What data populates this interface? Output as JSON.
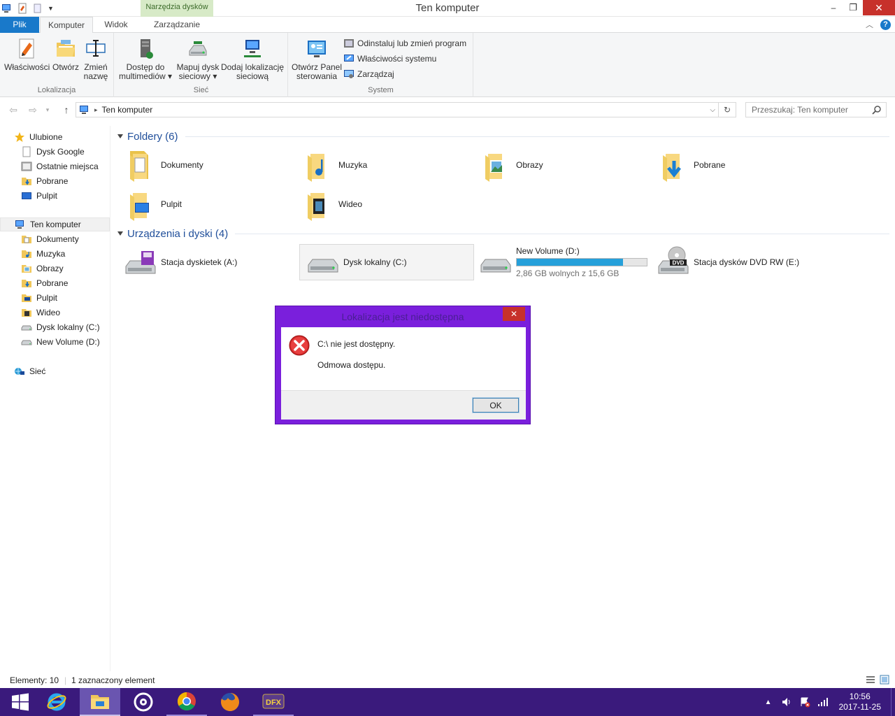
{
  "window": {
    "title": "Ten komputer",
    "context_tab_header": "Narzędzia dysków"
  },
  "ribbon_tabs": {
    "plik": "Plik",
    "komputer": "Komputer",
    "widok": "Widok",
    "zarzadzanie": "Zarządzanie"
  },
  "ribbon": {
    "groups": {
      "lokalizacja": "Lokalizacja",
      "siec": "Sieć",
      "system": "System"
    },
    "buttons": {
      "wlasciwosci": "Właściwości",
      "otworz": "Otwórz",
      "zmien_1": "Zmień",
      "zmien_2": "nazwę",
      "dostep_1": "Dostęp do",
      "dostep_2": "multimediów",
      "mapuj_1": "Mapuj dysk",
      "mapuj_2": "sieciowy",
      "dodaj_1": "Dodaj lokalizację",
      "dodaj_2": "sieciową",
      "panel_1": "Otwórz Panel",
      "panel_2": "sterowania",
      "odinstaluj": "Odinstaluj lub zmień program",
      "wlasciwosci_systemu": "Właściwości systemu",
      "zarzadzaj": "Zarządzaj"
    }
  },
  "address": {
    "path": "Ten komputer",
    "search_placeholder": "Przeszukaj: Ten komputer"
  },
  "navpane": {
    "favorites": [
      {
        "label": "Ulubione",
        "icon": "star-icon"
      },
      {
        "label": "Dysk Google",
        "icon": "file-icon"
      },
      {
        "label": "Ostatnie miejsca",
        "icon": "recent-places-icon"
      },
      {
        "label": "Pobrane",
        "icon": "downloads-folder-icon"
      },
      {
        "label": "Pulpit",
        "icon": "desktop-icon"
      }
    ],
    "computer": [
      {
        "label": "Ten komputer",
        "icon": "computer-icon"
      },
      {
        "label": "Dokumenty",
        "icon": "documents-folder-icon"
      },
      {
        "label": "Muzyka",
        "icon": "music-folder-icon"
      },
      {
        "label": "Obrazy",
        "icon": "pictures-folder-icon"
      },
      {
        "label": "Pobrane",
        "icon": "downloads-folder-icon"
      },
      {
        "label": "Pulpit",
        "icon": "desktop-folder-icon"
      },
      {
        "label": "Wideo",
        "icon": "video-folder-icon"
      },
      {
        "label": "Dysk lokalny (C:)",
        "icon": "drive-icon"
      },
      {
        "label": "New Volume (D:)",
        "icon": "drive-icon"
      }
    ],
    "network": {
      "label": "Sieć",
      "icon": "network-icon"
    }
  },
  "content": {
    "folders_header": "Foldery (6)",
    "folders": [
      "Dokumenty",
      "Muzyka",
      "Obrazy",
      "Pobrane",
      "Pulpit",
      "Wideo"
    ],
    "devices_header": "Urządzenia i dyski (4)",
    "devices": {
      "floppy": "Stacja dyskietek (A:)",
      "c_drive": "Dysk lokalny (C:)",
      "d_drive": "New Volume (D:)",
      "d_drive_capacity": "2,86 GB wolnych z 15,6 GB",
      "d_drive_used_fraction": 0.817,
      "dvd": "Stacja dysków DVD RW (E:)"
    }
  },
  "status": {
    "count": "Elementy: 10",
    "selected": "1 zaznaczony element"
  },
  "dialog": {
    "title": "Lokalizacja jest niedostępna",
    "message1": "C:\\ nie jest dostępny.",
    "message2": "Odmowa dostępu.",
    "ok": "OK"
  },
  "clock": {
    "time": "10:56",
    "date": "2017-11-25"
  },
  "colors": {
    "accent": "#1979ca",
    "taskbar": "#3a1a7c",
    "dialog_frame": "#7a1fdc",
    "capacity": "#26a0da"
  }
}
